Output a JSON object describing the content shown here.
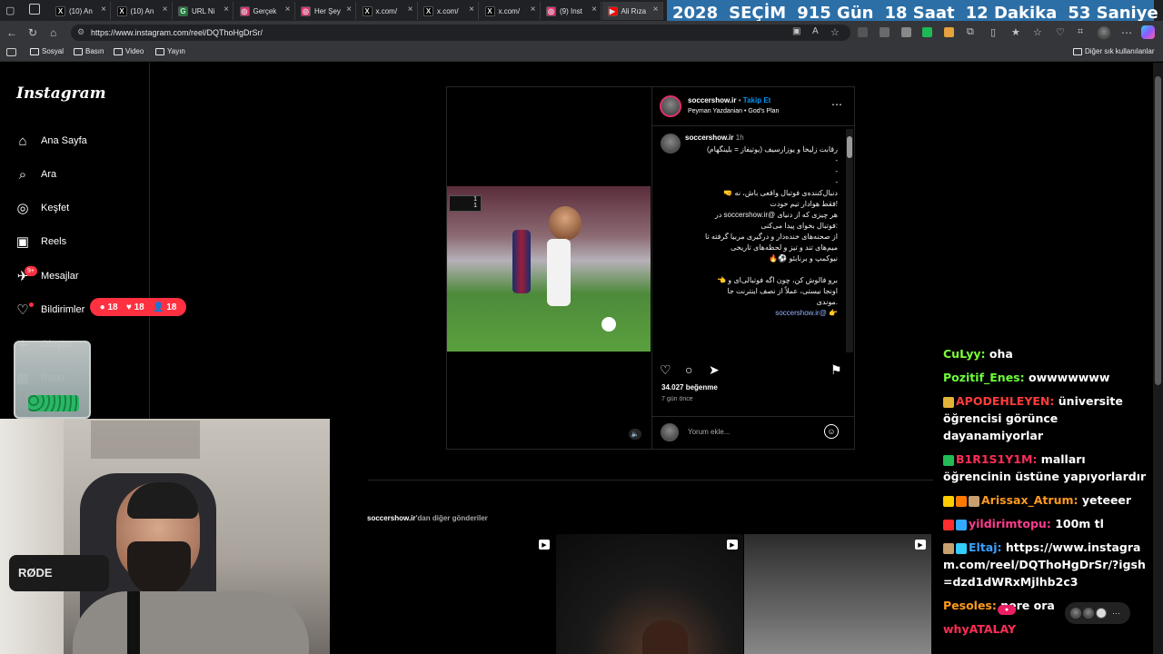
{
  "browser": {
    "tabs": [
      {
        "label": "(10) An",
        "icon": "x-logo-icon",
        "color": "#000000"
      },
      {
        "label": "(10) An",
        "icon": "x-logo-icon",
        "color": "#000000"
      },
      {
        "label": "URL Ni",
        "icon": "url-shortener-icon",
        "color": "#1a7f37"
      },
      {
        "label": "Gerçek",
        "icon": "instagram-icon",
        "color": "#e1306c"
      },
      {
        "label": "Her Şey",
        "icon": "instagram-icon",
        "color": "#e1306c"
      },
      {
        "label": "x.com/",
        "icon": "x-logo-icon",
        "color": "#000000"
      },
      {
        "label": "x.com/",
        "icon": "x-logo-icon",
        "color": "#000000"
      },
      {
        "label": "x.com/",
        "icon": "x-logo-icon",
        "color": "#000000"
      },
      {
        "label": "(9) Inst",
        "icon": "instagram-icon",
        "color": "#e1306c"
      },
      {
        "label": "Ali Rıza",
        "icon": "youtube-icon",
        "color": "#ff0000"
      }
    ],
    "url": "https://www.instagram.com/reel/DQThoHgDrSr/",
    "bookmarks": [
      "Sosyal",
      "Basın",
      "Video",
      "Yayın"
    ],
    "other_bookmarks": "Diğer sık kullanılanlar"
  },
  "countdown": {
    "year": "2028",
    "label": "SEÇİM",
    "days": "915 Gün",
    "hours": "18 Saat",
    "minutes": "12 Dakika",
    "seconds": "53 Saniye",
    "bg_color": "#2c6fa7"
  },
  "instagram": {
    "logo": "Instagram",
    "nav": [
      {
        "label": "Ana Sayfa",
        "icon": "home-icon"
      },
      {
        "label": "Ara",
        "icon": "search-icon"
      },
      {
        "label": "Keşfet",
        "icon": "compass-icon"
      },
      {
        "label": "Reels",
        "icon": "reels-icon"
      },
      {
        "label": "Mesajlar",
        "icon": "messenger-icon"
      },
      {
        "label": "Bildirimler",
        "icon": "heart-icon"
      },
      {
        "label": "Oluştur",
        "icon": "plus-icon"
      },
      {
        "label": "Pano",
        "icon": "dashboard-icon"
      }
    ],
    "messages_badge": "9+",
    "notifications": {
      "comments": "18",
      "likes": "18",
      "follows": "18",
      "color": "#ff3040"
    }
  },
  "post": {
    "username": "soccershow.ir",
    "follow": "Takip Et",
    "separator": "•",
    "audio": "Peyman Yazdanian • God's Plan",
    "caption_author": "soccershow.ir",
    "caption_time": "1h",
    "caption_lines": [
      "رقابت زلیخا و یوزارسیف (یوتیفاز = بلینگهام)",
      "-",
      "-",
      "-",
      "دنبال‌کننده‌ی فوتبال واقعی باش، نه 🤜",
      "!فقط هوادار تیم خودت",
      "هر چیزی که از دنیای @soccershow.ir در",
      ":فوتبال بخوای پیدا می‌کنی",
      "از صحنه‌های خنده‌دار و درگیری مربیا گرفته تا",
      "میم‌های تند و تیز و لحظه‌های تاریخی",
      "نیوکمپ و برنابئو ⚽🔥",
      "",
      "برو فالوش کن، چون اگه فوتبالی‌ای و 👈",
      "اونجا نیستی، عملاً از نصف اینترنت جا",
      ".موندی",
      "👉 @soccershow.ir"
    ],
    "likes": "34.027 beğenme",
    "time_ago": "7 gün önce",
    "comment_placeholder": "Yorum ekle...",
    "more_posts_user": "soccershow.ir",
    "more_posts_suffix": "'dan diğer gönderiler",
    "score_top": "1",
    "score_bottom": "1"
  },
  "chat": [
    {
      "user": "CuLyy",
      "text": "oha",
      "color": "#7cff3a",
      "badges": []
    },
    {
      "user": "Pozitif_Enes",
      "text": "owwwwwww",
      "color": "#6cff3a",
      "badges": []
    },
    {
      "user": "APODEHLEYEN",
      "text": "üniversite öğrencisi görünce dayanamiyorlar",
      "color": "#ff3b3b",
      "badges": [
        "#e3b43a"
      ]
    },
    {
      "user": "B1R1S1Y1M",
      "text": "malları öğrencinin üstüne yapıyorlardır",
      "color": "#ff2d55",
      "badges": [
        "#22bb55"
      ]
    },
    {
      "user": "Arissax_Atrum",
      "text": "yeteeer",
      "color": "#ff9a1f",
      "badges": [
        "#ffcc00",
        "#ff7a00",
        "#c8a070"
      ]
    },
    {
      "user": "yildirimtopu",
      "text": "100m tl",
      "color": "#ff3b8d",
      "badges": [
        "#ff2d2d",
        "#33aaff"
      ]
    },
    {
      "user": "Eltaj",
      "text": "https://www.instagram.com/reel/DQThoHgDrSr/?igsh=dzd1dWRxMjlhb2c3",
      "color": "#3aa0ff",
      "badges": [
        "#c8a070",
        "#33ccff"
      ]
    },
    {
      "user": "Pesoles",
      "text": "nere ora",
      "color": "#ff9a1f",
      "badges": []
    },
    {
      "user": "whyATALAY",
      "text": "",
      "color": "#ff2d55",
      "badges": []
    }
  ],
  "webcam": {
    "mic_brand": "RØDE"
  }
}
